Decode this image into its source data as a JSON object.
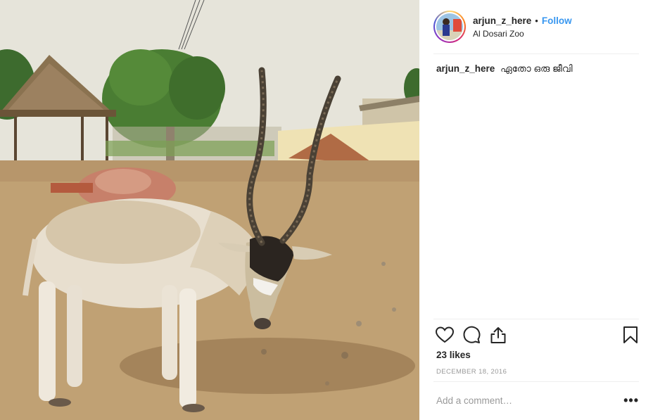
{
  "post": {
    "image_alt": "Addax antelope standing in a sandy zoo enclosure",
    "header": {
      "username": "arjun_z_here",
      "separator": "•",
      "follow_label": "Follow",
      "location": "Al Dosari Zoo",
      "avatar_icon": "profile-avatar"
    },
    "caption": {
      "username": "arjun_z_here",
      "text": "ഏതോ ഒരു ജീവി"
    },
    "actions": {
      "like_icon": "heart-icon",
      "comment_icon": "comment-icon",
      "share_icon": "share-icon",
      "save_icon": "bookmark-icon"
    },
    "likes": "23 likes",
    "date": "DECEMBER 18, 2016",
    "comment_box": {
      "placeholder": "Add a comment…",
      "more_label": "•••"
    },
    "colors": {
      "link_blue": "#3897f0",
      "text": "#262626",
      "muted": "#999999",
      "divider": "#efefef"
    }
  }
}
